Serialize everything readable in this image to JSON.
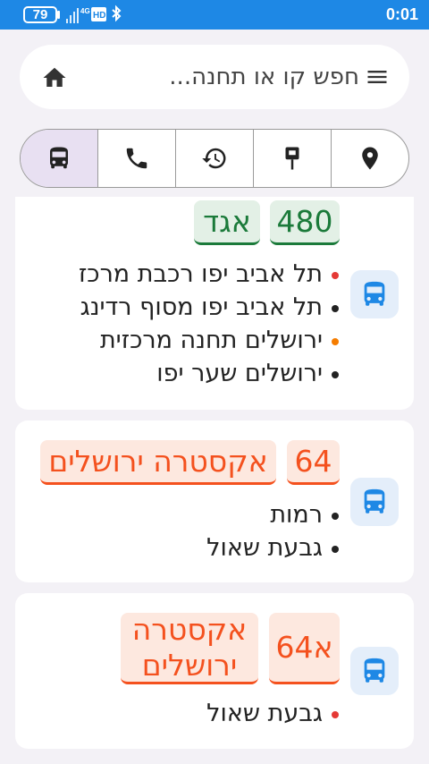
{
  "status_bar": {
    "battery": "79",
    "network": "4G",
    "hd": "HD",
    "time": "0:01"
  },
  "search": {
    "placeholder": "חפש קו או תחנה..."
  },
  "tabs": [
    {
      "name": "buses",
      "icon": "bus-icon",
      "selected": true
    },
    {
      "name": "phone",
      "icon": "phone-icon",
      "selected": false
    },
    {
      "name": "history",
      "icon": "history-icon",
      "selected": false
    },
    {
      "name": "stops",
      "icon": "bus-stop-sign-icon",
      "selected": false
    },
    {
      "name": "location",
      "icon": "location-pin-icon",
      "selected": false
    }
  ],
  "colors": {
    "status_bar": "#1e88e5",
    "egged_green": "#1b7a3a",
    "extra_orange": "#f4511e",
    "selected_tab": "#e8e0f2"
  },
  "routes": [
    {
      "line": "480",
      "operator": "אגד",
      "stops": [
        {
          "name": "תל אביב יפו רכבת מרכז",
          "dot": "red"
        },
        {
          "name": "תל אביב יפו מסוף רדינג",
          "dot": "black"
        },
        {
          "name": "ירושלים תחנה מרכזית",
          "dot": "orange"
        },
        {
          "name": "ירושלים שער יפו",
          "dot": "black"
        }
      ]
    },
    {
      "line": "64",
      "operator": "אקסטרה ירושלים",
      "stops": [
        {
          "name": "רמות",
          "dot": "black"
        },
        {
          "name": "גבעת שאול",
          "dot": "black"
        }
      ]
    },
    {
      "line": "64א",
      "operator": "אקסטרה ירושלים",
      "stops": [
        {
          "name": "גבעת שאול",
          "dot": "red"
        }
      ]
    }
  ]
}
